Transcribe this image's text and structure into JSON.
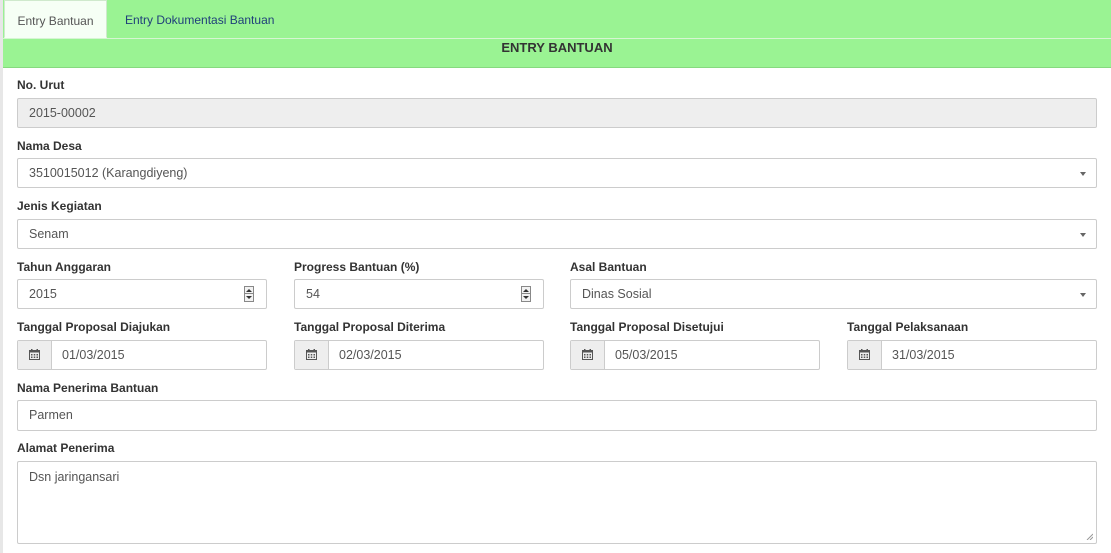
{
  "tabs": [
    {
      "label": "Entry Bantuan",
      "active": true
    },
    {
      "label": "Entry Dokumentasi Bantuan",
      "active": false
    }
  ],
  "form_title": "ENTRY BANTUAN",
  "fields": {
    "no_urut": {
      "label": "No. Urut",
      "value": "2015-00002"
    },
    "nama_desa": {
      "label": "Nama Desa",
      "value": "3510015012 (Karangdiyeng)"
    },
    "jenis_kegiatan": {
      "label": "Jenis Kegiatan",
      "value": "Senam"
    },
    "tahun_anggaran": {
      "label": "Tahun Anggaran",
      "value": "2015"
    },
    "progress_bantuan": {
      "label": "Progress Bantuan (%)",
      "value": "54"
    },
    "asal_bantuan": {
      "label": "Asal Bantuan",
      "value": "Dinas Sosial"
    },
    "tgl_diajukan": {
      "label": "Tanggal Proposal Diajukan",
      "value": "01/03/2015"
    },
    "tgl_diterima": {
      "label": "Tanggal Proposal Diterima",
      "value": "02/03/2015"
    },
    "tgl_disetujui": {
      "label": "Tanggal Proposal Disetujui",
      "value": "05/03/2015"
    },
    "tgl_pelaksanaan": {
      "label": "Tanggal Pelaksanaan",
      "value": "31/03/2015"
    },
    "nama_penerima": {
      "label": "Nama Penerima Bantuan",
      "value": "Parmen"
    },
    "alamat_penerima": {
      "label": "Alamat Penerima",
      "value": "Dsn jaringansari"
    }
  },
  "icons": {
    "date": "calendar-icon",
    "select": "caret-down-icon",
    "number": "spinner-icon",
    "resize": "resize-grip-icon"
  },
  "colors": {
    "header_bg": "#9af393",
    "readonly_bg": "#eeeeee",
    "border": "#cccccc",
    "link": "#1f3f7a"
  }
}
